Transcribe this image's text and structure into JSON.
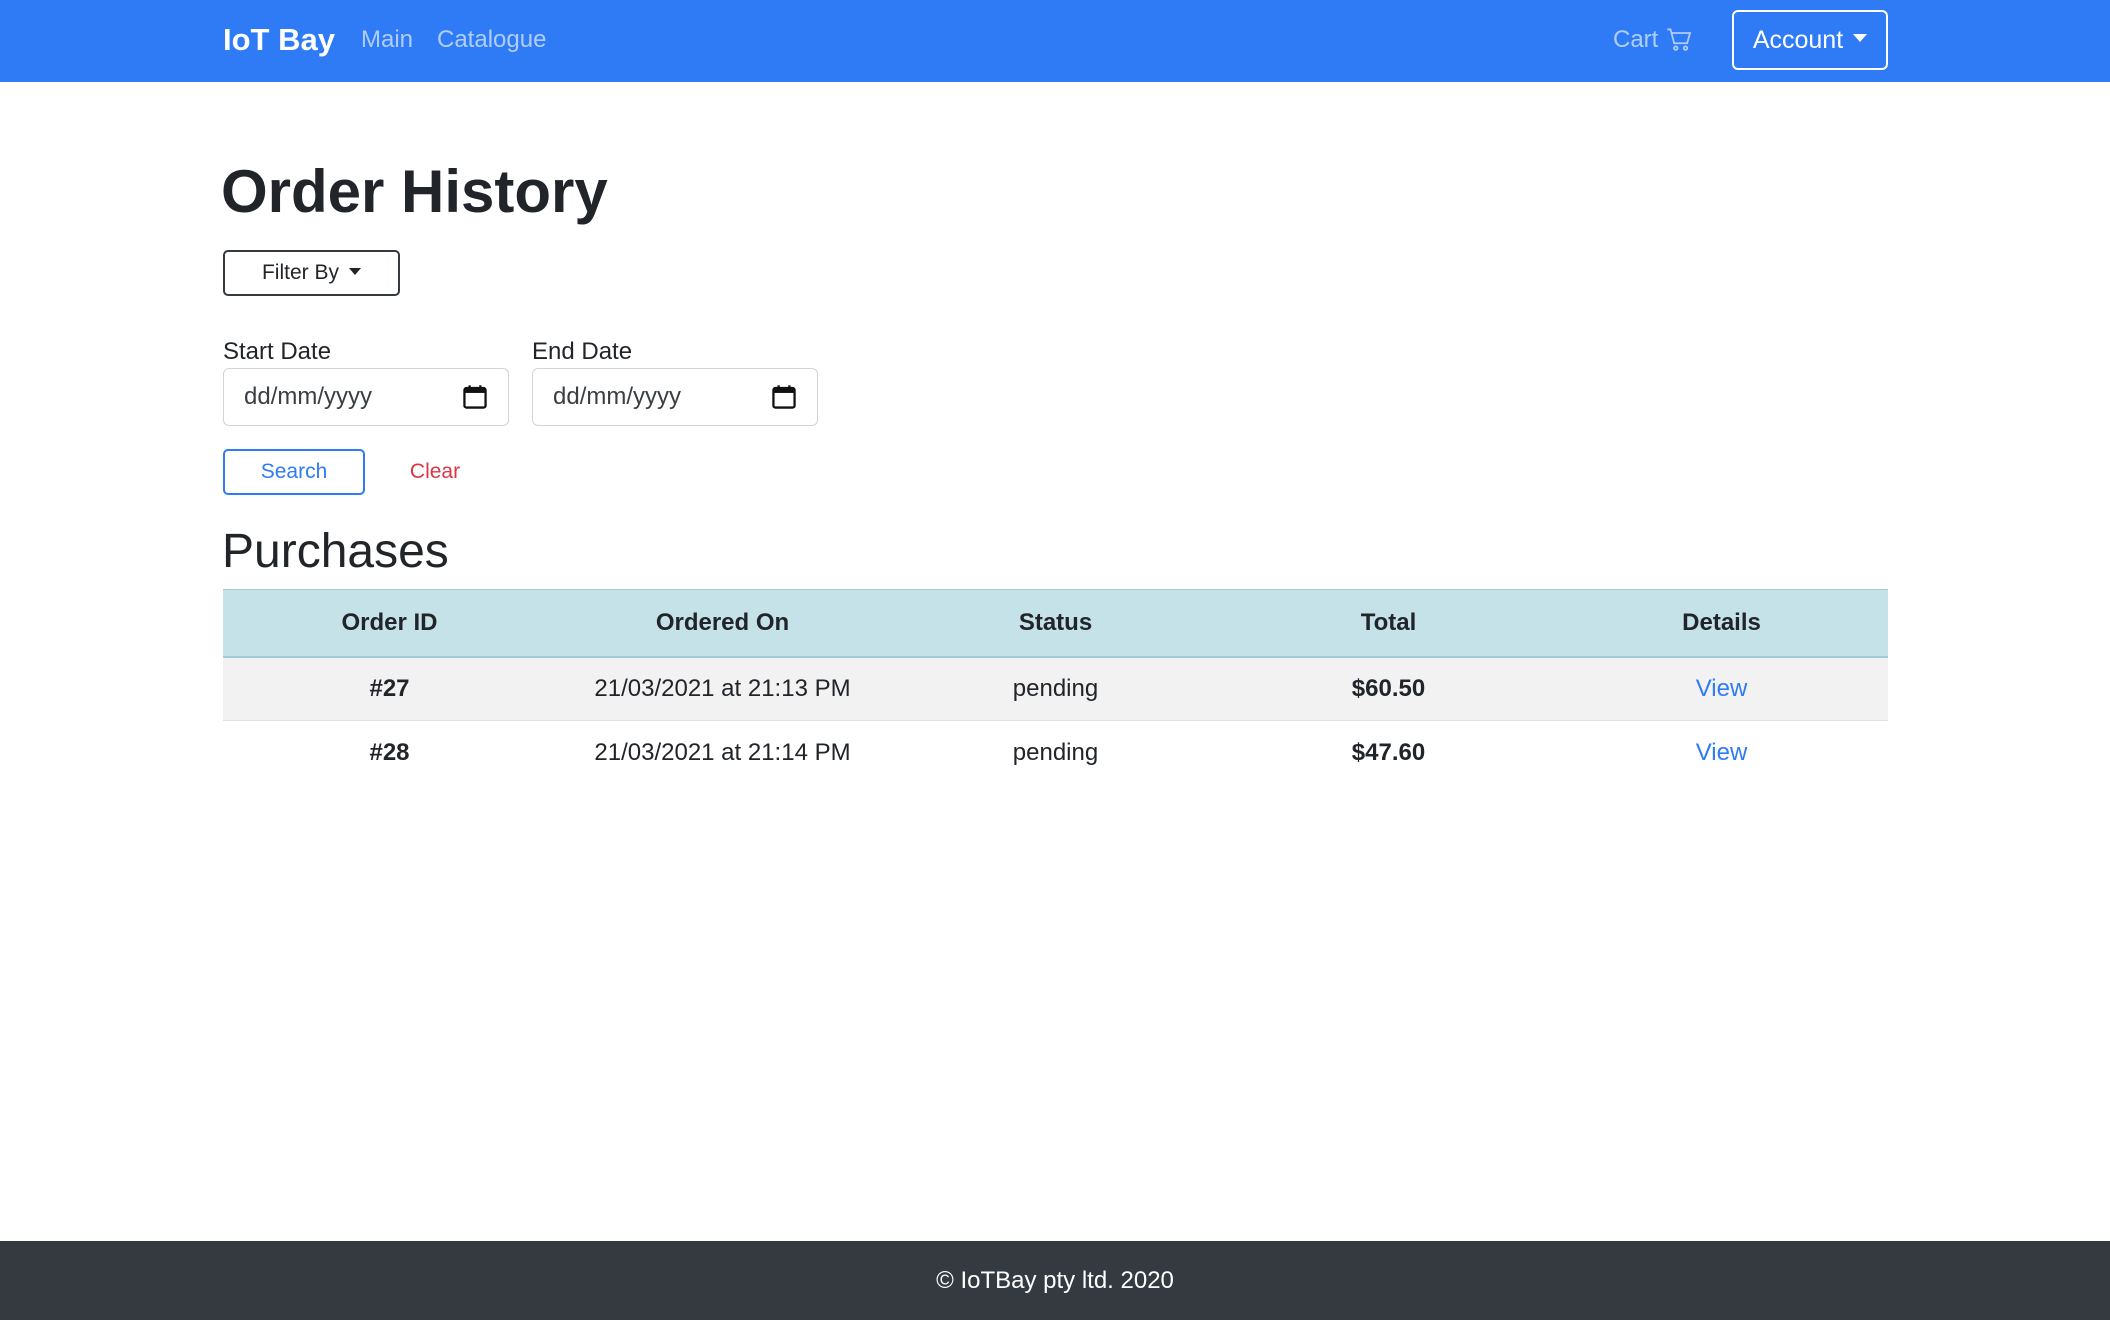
{
  "navbar": {
    "brand": "IoT Bay",
    "links": [
      {
        "label": "Main"
      },
      {
        "label": "Catalogue"
      }
    ],
    "cart_label": "Cart",
    "cart_icon": "shopping-cart-icon",
    "account_label": "Account",
    "background_color": "#2f7bf5"
  },
  "page": {
    "title": "Order History",
    "filter_label": "Filter By",
    "start_date_label": "Start Date",
    "end_date_label": "End Date",
    "date_placeholder": "dd/mm/yyyy",
    "calendar_icon": "calendar-icon",
    "search_label": "Search",
    "clear_label": "Clear",
    "section_title": "Purchases"
  },
  "table": {
    "headers": [
      "Order ID",
      "Ordered On",
      "Status",
      "Total",
      "Details"
    ],
    "rows": [
      {
        "order_id": "#27",
        "ordered_on": "21/03/2021 at 21:13 PM",
        "status": "pending",
        "total": "$60.50",
        "details": "View"
      },
      {
        "order_id": "#28",
        "ordered_on": "21/03/2021 at 21:14 PM",
        "status": "pending",
        "total": "$47.60",
        "details": "View"
      }
    ],
    "header_color": "#c5e2e9",
    "status_color": "#3b9bb0"
  },
  "footer": {
    "text": "© IoTBay pty ltd. 2020"
  }
}
